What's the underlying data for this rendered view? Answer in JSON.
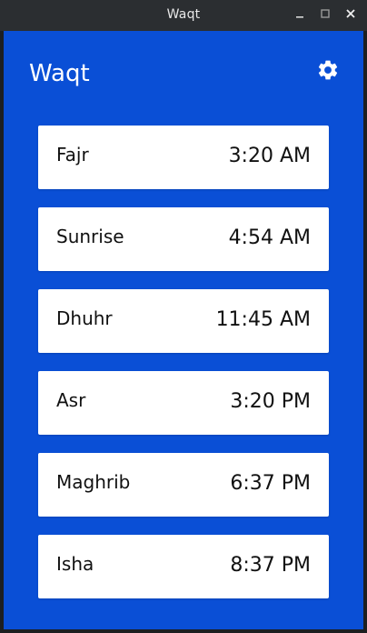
{
  "window": {
    "title": "Waqt"
  },
  "header": {
    "title": "Waqt"
  },
  "icons": {
    "settings": "gear-icon",
    "minimize": "minimize-icon",
    "maximize": "maximize-icon",
    "close": "close-icon"
  },
  "colors": {
    "app_background": "#0a4fd6",
    "card_background": "#ffffff",
    "titlebar": "#2b2e31"
  },
  "prayers": [
    {
      "name": "Fajr",
      "time": "3:20 AM"
    },
    {
      "name": "Sunrise",
      "time": "4:54 AM"
    },
    {
      "name": "Dhuhr",
      "time": "11:45 AM"
    },
    {
      "name": "Asr",
      "time": "3:20 PM"
    },
    {
      "name": "Maghrib",
      "time": "6:37 PM"
    },
    {
      "name": "Isha",
      "time": "8:37 PM"
    }
  ]
}
